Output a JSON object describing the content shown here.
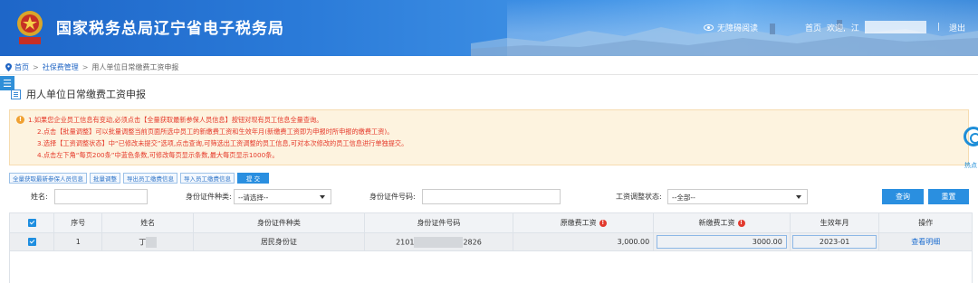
{
  "header": {
    "site_title": "国家税务总局辽宁省电子税务局",
    "barrier_free": "无障碍阅读",
    "home": "首页",
    "welcome": "欢迎,",
    "welcome_initial": "江",
    "separator": "|",
    "logout": "退出",
    "emblem_text": "中国税务"
  },
  "breadcrumb": {
    "home": "首页",
    "section": "社保费管理",
    "current": "用人单位日常缴费工资申报",
    "gt": ">"
  },
  "page": {
    "title": "用人单位日常缴费工资申报",
    "side_toggle": "☰"
  },
  "notice": {
    "icon": "!",
    "lines": [
      "1.如果您企业员工信息有变动,必须点击【全量获取最新参保人员信息】按钮对现有员工信息全量查询。",
      "2.点击【批量调整】可以批量调整当前页面所选中员工的新缴费工资和生效年月(新缴费工资即为申报时所申报的缴费工资)。",
      "3.选择【工资调整状态】中“已修改未提交”选项,点击查询,可筛选出工资调整的员工信息,可对本次修改的员工信息进行单独提交。",
      "4.点击左下角“每页200条”中蓝色条数,可修改每页显示条数,最大每页显示1000条。"
    ]
  },
  "float_help": {
    "label": "热点"
  },
  "toolbar": {
    "buttons": [
      "全量获取最新参保人员信息",
      "批量调整",
      "导出员工缴费信息",
      "导入员工缴费信息"
    ],
    "submit": "提 交"
  },
  "filters": {
    "name_label": "姓名:",
    "name_value": "",
    "id_type_label": "身份证件种类:",
    "id_type_value": "--请选择--",
    "id_no_label": "身份证件号码:",
    "id_no_value": "",
    "wage_status_label": "工资调整状态:",
    "wage_status_value": "--全部--",
    "query": "查询",
    "reset": "重置"
  },
  "table": {
    "columns": [
      "",
      "序号",
      "姓名",
      "身份证件种类",
      "身份证件号码",
      "原缴费工资",
      "新缴费工资",
      "生效年月",
      "操作"
    ],
    "rows": [
      {
        "checked": true,
        "index": "1",
        "name_prefix": "丁",
        "id_type": "居民身份证",
        "id_prefix": "2101",
        "id_suffix": "2826",
        "old_wage": "3,000.00",
        "new_wage": "3000.00",
        "effective_month": "2023-01",
        "action": "查看明细"
      }
    ]
  },
  "colors": {
    "header_blue": "#2a7ad8",
    "accent": "#2a8fe0",
    "notice_text": "#e5392a",
    "notice_bg": "#fdf3df"
  }
}
